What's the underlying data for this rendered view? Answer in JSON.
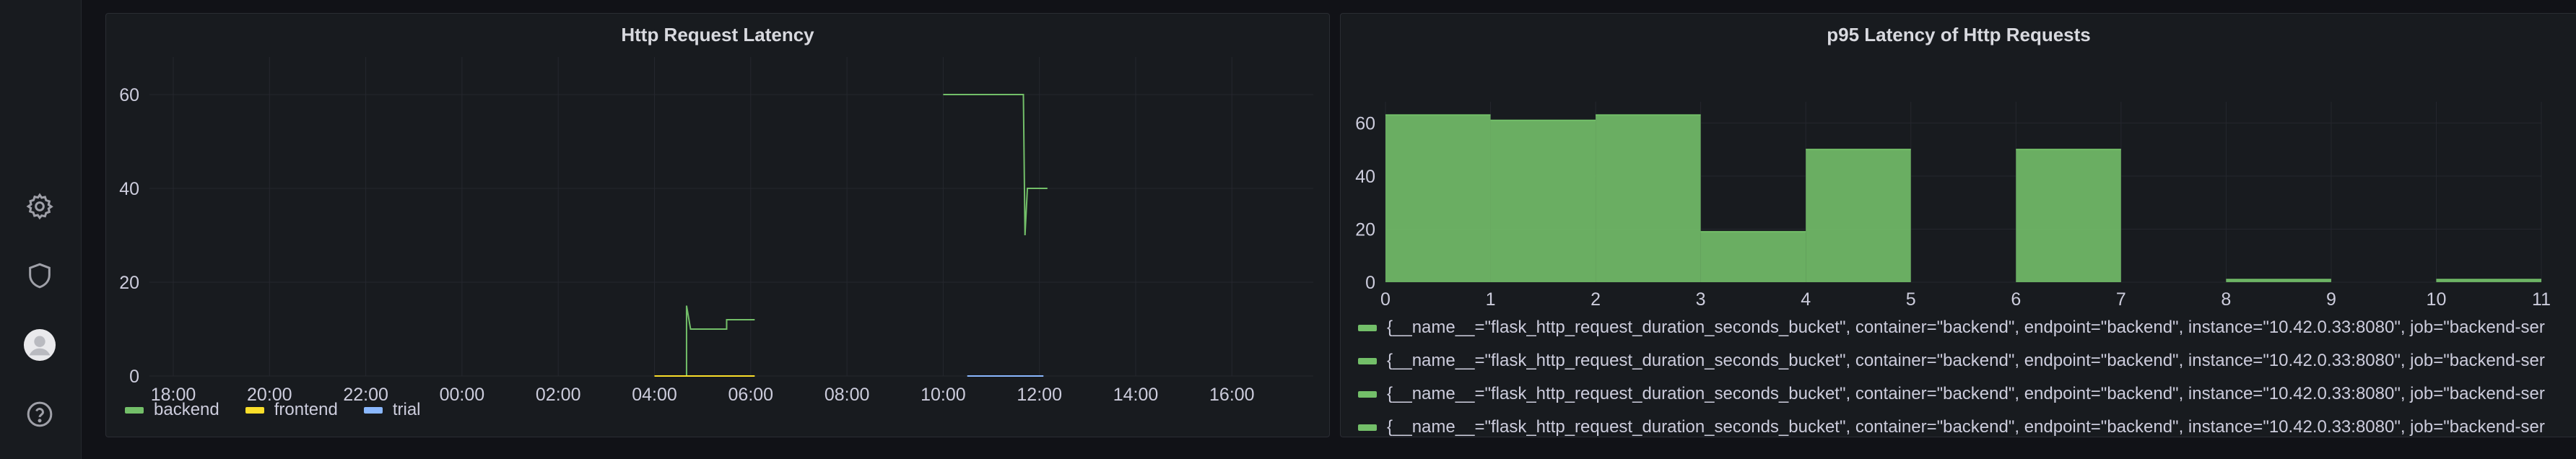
{
  "sidebar": {
    "icons": [
      "gear-icon",
      "shield-icon",
      "user-avatar",
      "help-icon"
    ]
  },
  "panels": [
    {
      "title": "Http Request Latency",
      "chart_data": {
        "type": "line",
        "title": "Http Request Latency",
        "xlabel": "",
        "ylabel": "",
        "x_ticks": [
          "18:00",
          "20:00",
          "22:00",
          "00:00",
          "02:00",
          "04:00",
          "06:00",
          "08:00",
          "10:00",
          "12:00",
          "14:00",
          "16:00"
        ],
        "y_ticks": [
          0,
          20,
          40,
          60
        ],
        "ylim": [
          0,
          68
        ],
        "grid": true,
        "legend_position": "bottom-left",
        "series": [
          {
            "name": "backend",
            "color": "#73bf69",
            "segments": [
              [
                [
                  "04:40",
                  0
                ],
                [
                  "04:40",
                  15
                ],
                [
                  "04:45",
                  10
                ],
                [
                  "05:30",
                  10
                ],
                [
                  "05:30",
                  12
                ],
                [
                  "06:05",
                  12
                ]
              ],
              [
                [
                  "10:00",
                  60
                ],
                [
                  "11:40",
                  60
                ],
                [
                  "11:42",
                  30
                ],
                [
                  "11:45",
                  40
                ],
                [
                  "12:10",
                  40
                ]
              ]
            ]
          },
          {
            "name": "frontend",
            "color": "#fade2a",
            "segments": [
              [
                [
                  "04:00",
                  0
                ],
                [
                  "06:05",
                  0
                ]
              ]
            ]
          },
          {
            "name": "trial",
            "color": "#8ab8ff",
            "segments": [
              [
                [
                  "10:30",
                  0
                ],
                [
                  "12:05",
                  0
                ]
              ]
            ]
          }
        ]
      }
    },
    {
      "title": "p95 Latency of Http Requests",
      "chart_data": {
        "type": "bar",
        "title": "p95 Latency of Http Requests",
        "xlabel": "",
        "ylabel": "",
        "x_ticks": [
          0,
          1,
          2,
          3,
          4,
          5,
          6,
          7,
          8,
          9,
          10,
          11
        ],
        "y_ticks": [
          0,
          20,
          40,
          60
        ],
        "ylim": [
          0,
          68
        ],
        "xlim": [
          0,
          11
        ],
        "grid": true,
        "legend_position": "bottom",
        "bars": [
          {
            "x0": 0,
            "x1": 1,
            "value": 63
          },
          {
            "x0": 1,
            "x1": 2,
            "value": 61
          },
          {
            "x0": 2,
            "x1": 3,
            "value": 63
          },
          {
            "x0": 3,
            "x1": 4,
            "value": 19
          },
          {
            "x0": 4,
            "x1": 5,
            "value": 50
          },
          {
            "x0": 6,
            "x1": 7,
            "value": 50
          },
          {
            "x0": 8,
            "x1": 9,
            "value": 1
          },
          {
            "x0": 10,
            "x1": 11,
            "value": 1
          }
        ],
        "bar_color": "#73bf69",
        "legend": [
          "{__name__=\"flask_http_request_duration_seconds_bucket\", container=\"backend\", endpoint=\"backend\", instance=\"10.42.0.33:8080\", job=\"backend-ser",
          "{__name__=\"flask_http_request_duration_seconds_bucket\", container=\"backend\", endpoint=\"backend\", instance=\"10.42.0.33:8080\", job=\"backend-ser",
          "{__name__=\"flask_http_request_duration_seconds_bucket\", container=\"backend\", endpoint=\"backend\", instance=\"10.42.0.33:8080\", job=\"backend-ser",
          "{__name__=\"flask_http_request_duration_seconds_bucket\", container=\"backend\", endpoint=\"backend\", instance=\"10.42.0.33:8080\", job=\"backend-ser"
        ]
      }
    }
  ]
}
